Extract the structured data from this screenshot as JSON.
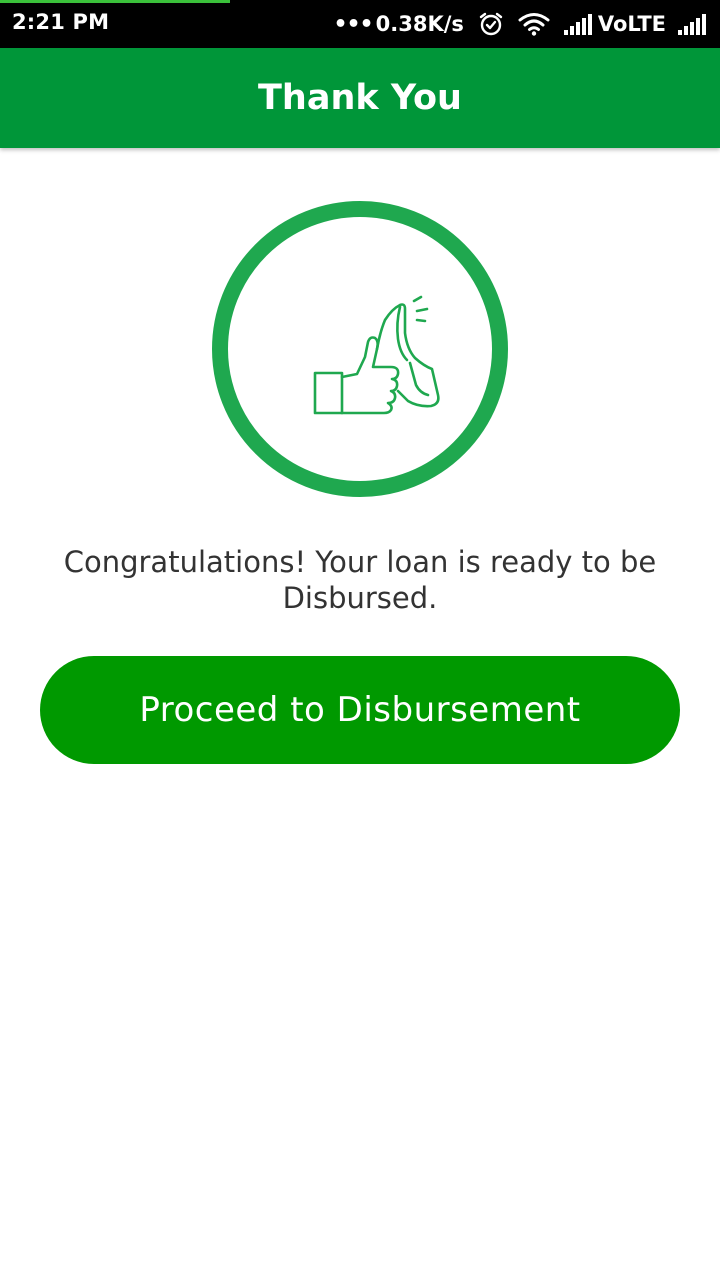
{
  "status_bar": {
    "time": "2:21 PM",
    "dots": "•••",
    "net_speed": "0.38K/s",
    "volte_label": "VoLTE",
    "icons": [
      "alarm-icon",
      "wifi-icon",
      "signal-icon",
      "signal-icon"
    ],
    "page_load_progress": 0.32
  },
  "app_bar": {
    "title": "Thank You"
  },
  "main": {
    "illustration_icon": "thumbs-up-icon",
    "message": "Congratulations! Your loan is ready to be Disbursed.",
    "proceed_button_label": "Proceed to Disbursement"
  },
  "colors": {
    "primary_green": "#009639",
    "ring_green": "#1fa84f",
    "button_green": "#009900",
    "progress_green": "#3bc13b",
    "text_dark": "#333333"
  }
}
